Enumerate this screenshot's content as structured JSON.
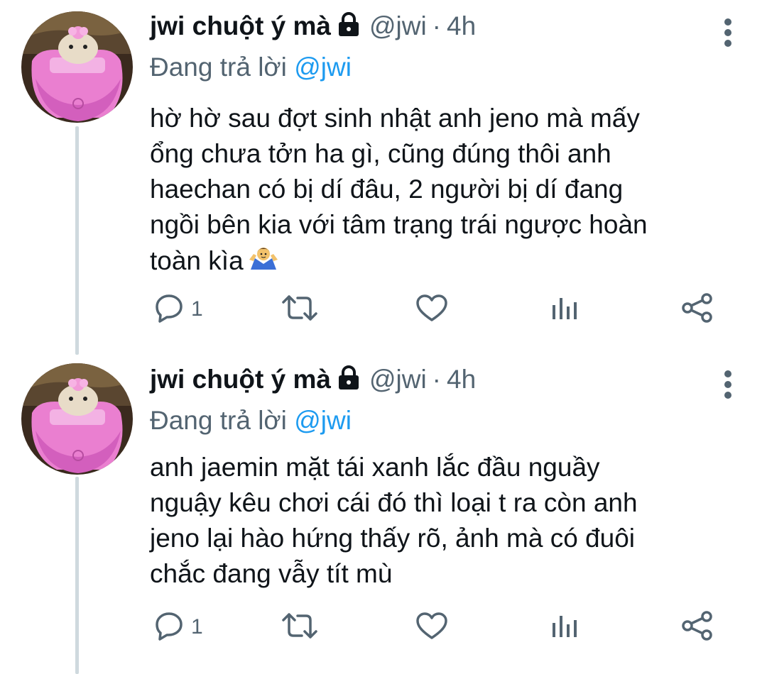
{
  "colors": {
    "accent": "#1d9bf0",
    "secondary_text": "#536471",
    "primary_text": "#0f1419",
    "thread_line": "#cfd9de"
  },
  "tweets": [
    {
      "author_name": "jwi chuột ý mà",
      "locked_icon": "lock-icon",
      "handle": "@jwi",
      "separator": "·",
      "time": "4h",
      "replying_prefix": "Đang trả lời",
      "replying_to": "@jwi",
      "text_lines": [
        "hờ hờ sau đợt sinh nhật anh jeno mà mấy",
        "ổng chưa tởn ha gì, cũng đúng thôi anh",
        "haechan có bị dí đâu, 2 người bị dí đang",
        "ngồi bên kia với tâm trạng trái ngược hoàn",
        "toàn kìa"
      ],
      "emoji": "person-shrugging-emoji",
      "reply_count": "1"
    },
    {
      "author_name": "jwi chuột ý mà",
      "locked_icon": "lock-icon",
      "handle": "@jwi",
      "separator": "·",
      "time": "4h",
      "replying_prefix": "Đang trả lời",
      "replying_to": "@jwi",
      "text_lines": [
        "anh jaemin mặt tái xanh lắc đầu nguầy",
        "nguậy kêu chơi cái đó thì loại t ra còn anh",
        "jeno lại hào hứng thấy rõ, ảnh mà có đuôi",
        "chắc đang vẫy tít mù"
      ],
      "reply_count": "1"
    }
  ]
}
